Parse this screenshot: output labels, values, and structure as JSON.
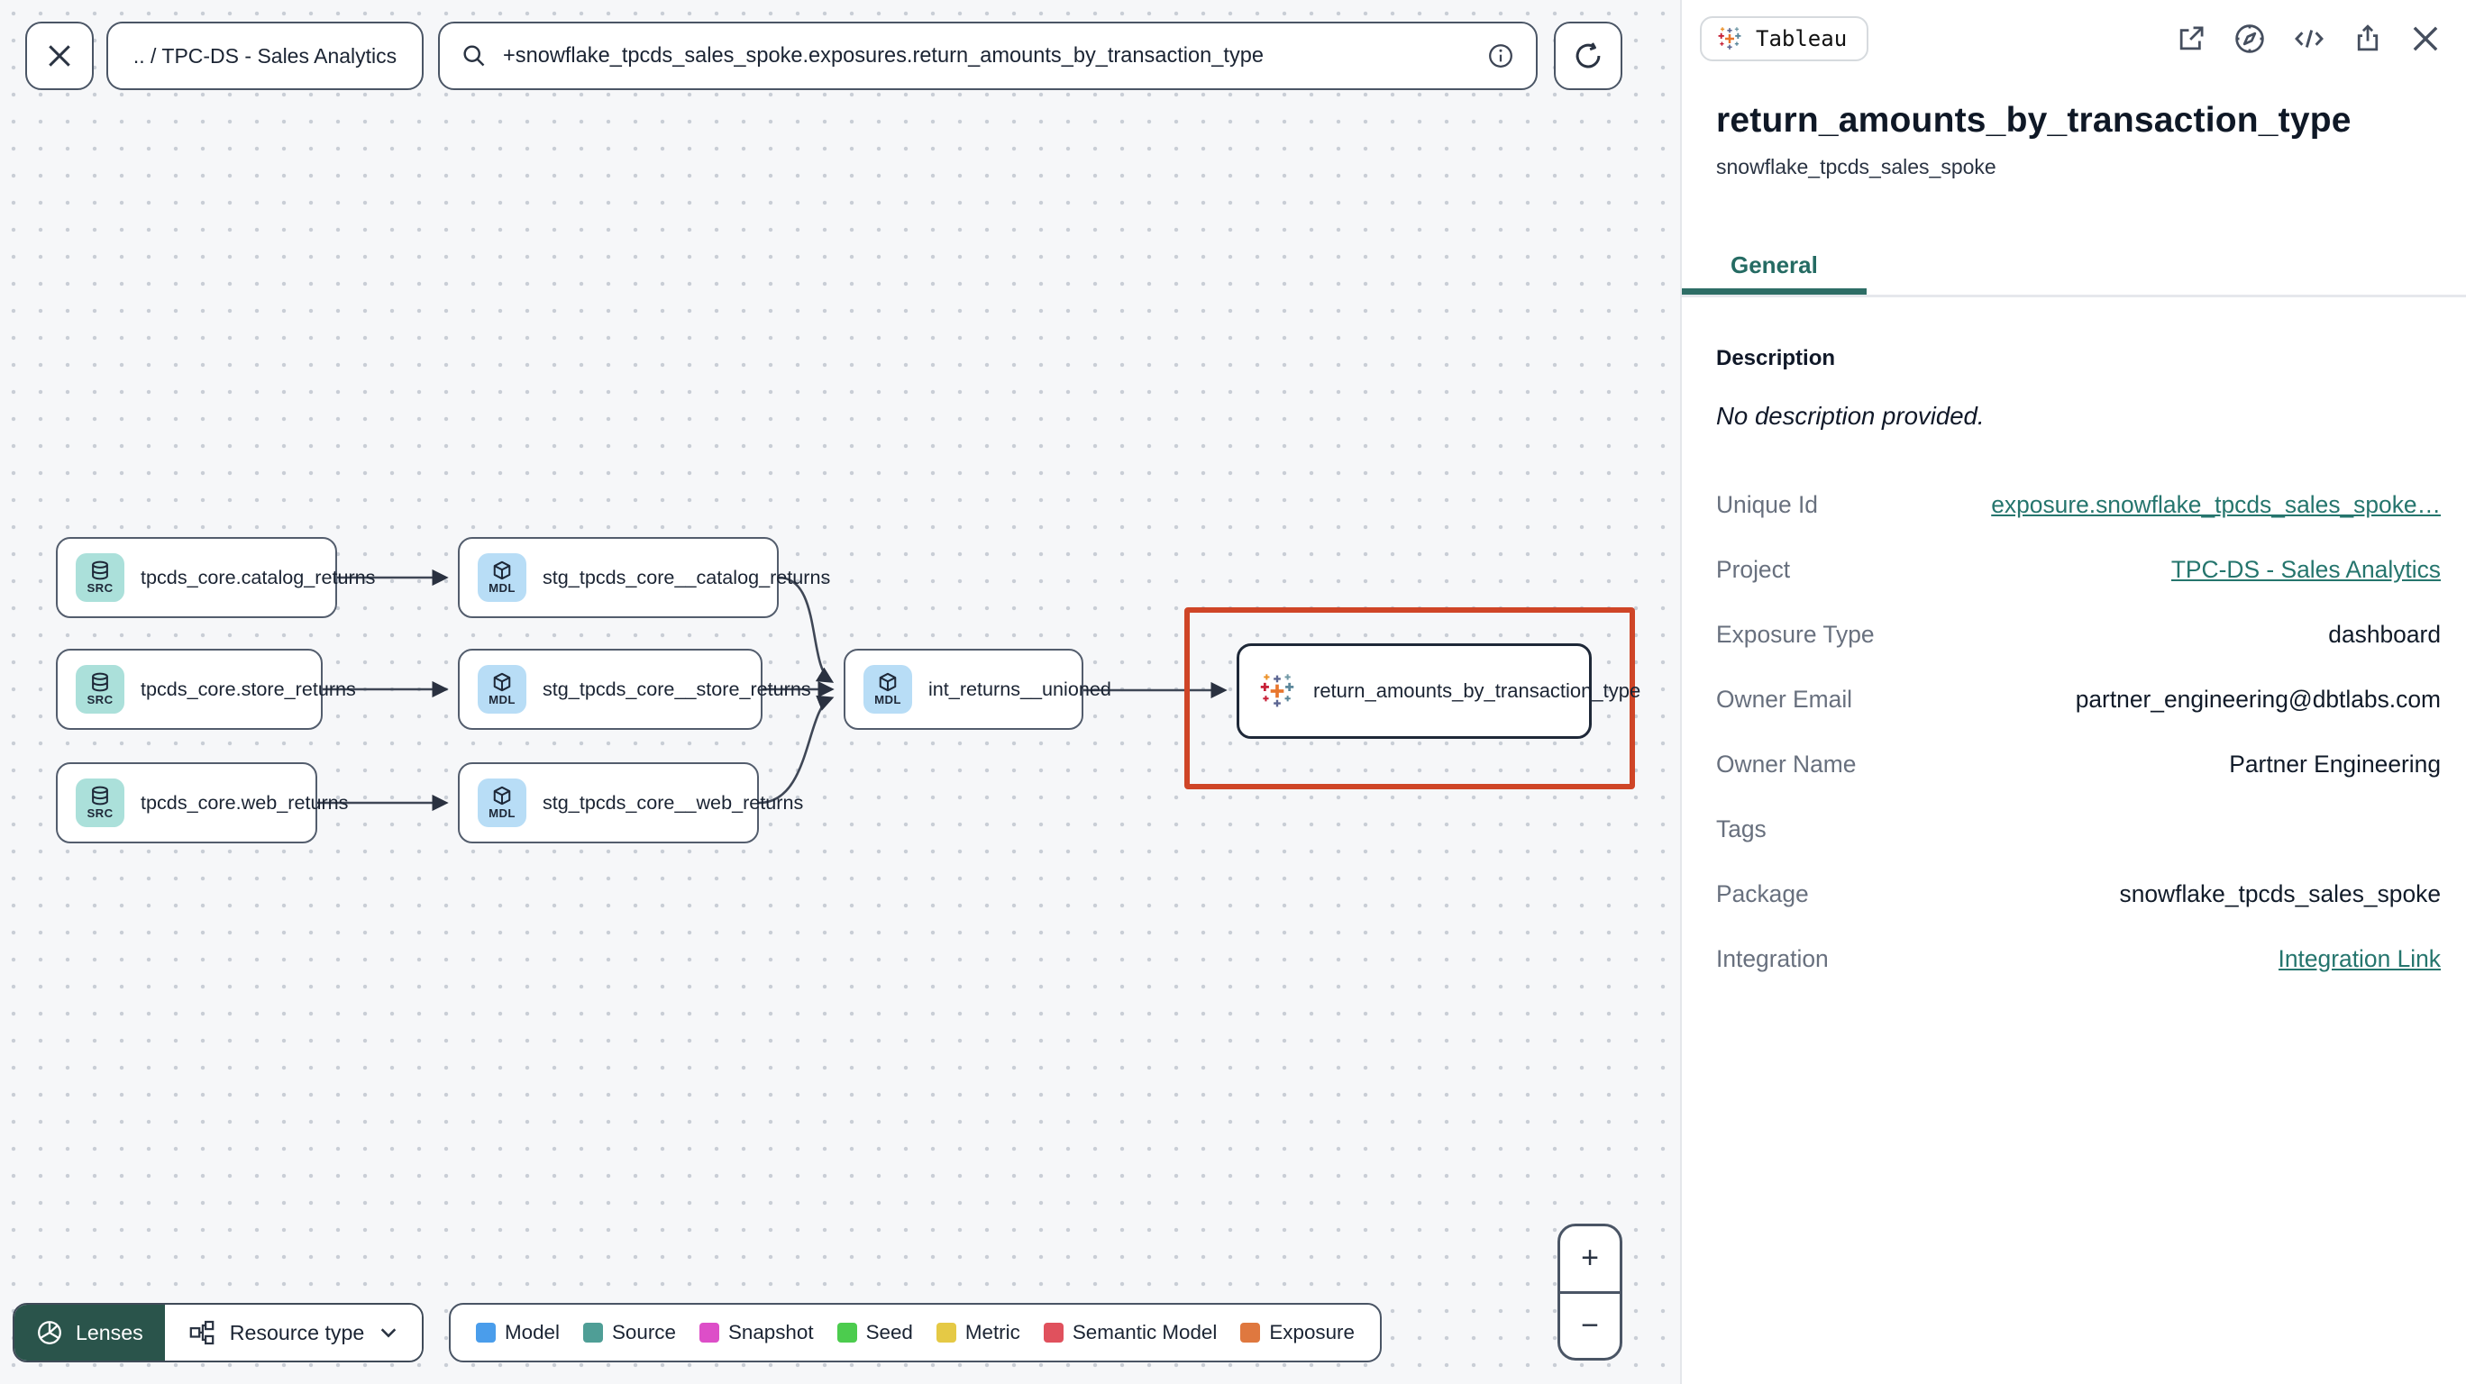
{
  "topbar": {
    "breadcrumb": ".. / TPC-DS - Sales Analytics",
    "search_value": "+snowflake_tpcds_sales_spoke.exposures.return_amounts_by_transaction_type"
  },
  "graph": {
    "nodes": [
      {
        "id": "src-catalog",
        "type": "source",
        "badge": "SRC",
        "label": "tpcds_core.catalog_returns"
      },
      {
        "id": "src-store",
        "type": "source",
        "badge": "SRC",
        "label": "tpcds_core.store_returns"
      },
      {
        "id": "src-web",
        "type": "source",
        "badge": "SRC",
        "label": "tpcds_core.web_returns"
      },
      {
        "id": "stg-catalog",
        "type": "model",
        "badge": "MDL",
        "label": "stg_tpcds_core__catalog_returns"
      },
      {
        "id": "stg-store",
        "type": "model",
        "badge": "MDL",
        "label": "stg_tpcds_core__store_returns"
      },
      {
        "id": "stg-web",
        "type": "model",
        "badge": "MDL",
        "label": "stg_tpcds_core__web_returns"
      },
      {
        "id": "int-unioned",
        "type": "model",
        "badge": "MDL",
        "label": "int_returns__unioned"
      },
      {
        "id": "exposure",
        "type": "exposure",
        "label": "return_amounts_by_transaction_type",
        "selected": true
      }
    ]
  },
  "toolbar": {
    "lenses_label": "Lenses",
    "resource_type_label": "Resource type"
  },
  "legend": {
    "items": [
      {
        "label": "Model",
        "color": "#4a9deb"
      },
      {
        "label": "Source",
        "color": "#4f9e96"
      },
      {
        "label": "Snapshot",
        "color": "#dd4ec8"
      },
      {
        "label": "Seed",
        "color": "#4ccc4e"
      },
      {
        "label": "Metric",
        "color": "#e5c945"
      },
      {
        "label": "Semantic Model",
        "color": "#e0515d"
      },
      {
        "label": "Exposure",
        "color": "#df783f"
      }
    ]
  },
  "zoom_controls": {
    "zoom_in": "+",
    "zoom_out": "−"
  },
  "panel": {
    "badge_label": "Tableau",
    "title": "return_amounts_by_transaction_type",
    "subtitle": "snowflake_tpcds_sales_spoke",
    "tab_general": "General",
    "description_heading": "Description",
    "description_empty": "No description provided.",
    "details": [
      {
        "label": "Unique Id",
        "value": "exposure.snowflake_tpcds_sales_spoke…",
        "link": true
      },
      {
        "label": "Project",
        "value": "TPC-DS - Sales Analytics",
        "link": true
      },
      {
        "label": "Exposure Type",
        "value": "dashboard",
        "link": false
      },
      {
        "label": "Owner Email",
        "value": "partner_engineering@dbtlabs.com",
        "link": false
      },
      {
        "label": "Owner Name",
        "value": "Partner Engineering",
        "link": false
      },
      {
        "label": "Tags",
        "value": "",
        "link": false
      },
      {
        "label": "Package",
        "value": "snowflake_tpcds_sales_spoke",
        "link": false
      },
      {
        "label": "Integration",
        "value": "Integration Link",
        "link": true
      }
    ]
  },
  "colors": {
    "accent_teal": "#2e6e66",
    "selection_red": "#cf4527",
    "source_icon_bg": "#abe0da",
    "model_icon_bg": "#b8ddf6",
    "lenses_green": "#2a544b"
  }
}
